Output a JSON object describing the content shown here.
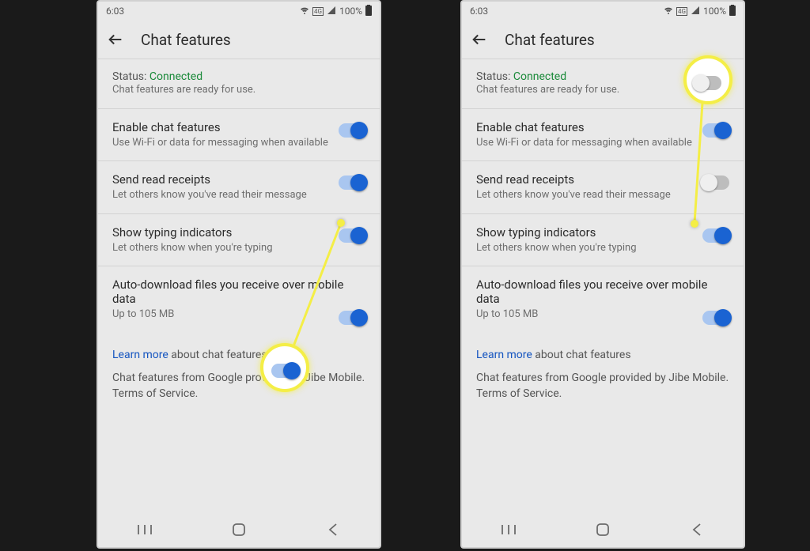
{
  "statusbar": {
    "time": "6:03",
    "battery": "100%"
  },
  "header": {
    "title": "Chat features"
  },
  "status": {
    "label": "Status:",
    "value": "Connected",
    "sub": "Chat features are ready for use."
  },
  "rows": {
    "enable": {
      "title": "Enable chat features",
      "sub": "Use Wi-Fi or data for messaging when available"
    },
    "receipts": {
      "title": "Send read receipts",
      "sub": "Let others know you've read their message"
    },
    "typing": {
      "title": "Show typing indicators",
      "sub": "Let others know when you're typing"
    },
    "autodl": {
      "title": "Auto-download files you receive over mobile data",
      "sub": "Up to 105 MB"
    }
  },
  "learn": {
    "link": "Learn more",
    "rest": " about chat features"
  },
  "footer": "Chat features from Google provided by Jibe Mobile. Terms of Service.",
  "toggles": {
    "left": {
      "enable": "on",
      "receipts": "on",
      "typing": "on",
      "autodl": "on"
    },
    "right": {
      "enable": "on",
      "receipts": "off",
      "typing": "on",
      "autodl": "on"
    }
  }
}
